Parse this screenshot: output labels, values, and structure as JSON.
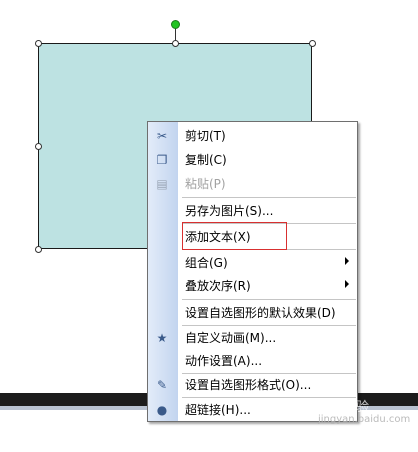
{
  "menu": {
    "items": [
      {
        "label": "剪切(T)",
        "icon": "scissors-icon",
        "enabled": true
      },
      {
        "label": "复制(C)",
        "icon": "copy-icon",
        "enabled": true
      },
      {
        "label": "粘贴(P)",
        "icon": "paste-icon",
        "enabled": false
      },
      {
        "label": "另存为图片(S)...",
        "enabled": true
      },
      {
        "label": "添加文本(X)",
        "enabled": true,
        "highlighted": true
      },
      {
        "label": "组合(G)",
        "enabled": true,
        "submenu": true
      },
      {
        "label": "叠放次序(R)",
        "enabled": true,
        "submenu": true
      },
      {
        "label": "设置自选图形的默认效果(D)",
        "enabled": true
      },
      {
        "label": "自定义动画(M)...",
        "icon": "custom-animation-icon",
        "enabled": true
      },
      {
        "label": "动作设置(A)...",
        "enabled": true
      },
      {
        "label": "设置自选图形格式(O)...",
        "icon": "format-shape-icon",
        "enabled": true
      },
      {
        "label": "超链接(H)...",
        "icon": "hyperlink-icon",
        "enabled": true
      }
    ]
  },
  "watermark": {
    "text": "Baidu经验",
    "subtext": "jingyan.baidu.com"
  },
  "colors": {
    "shape_fill": "#bde2e2",
    "highlight_border": "#d83030",
    "rotation_handle": "#22c422"
  }
}
